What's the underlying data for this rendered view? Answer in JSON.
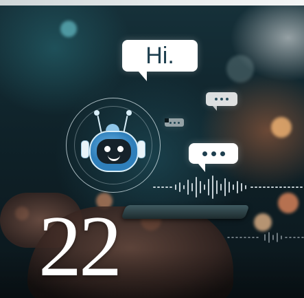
{
  "image": {
    "greeting_text": "Hi.",
    "number_text": "22",
    "icons": [
      "chatbot-robot-icon",
      "speech-bubble-icon",
      "typing-dots-icon",
      "sound-wave-icon"
    ],
    "colors": {
      "bubble": "#ffffff",
      "bubble_text": "#1e3f4f",
      "robot_blue": "#2f7fba",
      "background_dark": "#0f2229"
    }
  }
}
